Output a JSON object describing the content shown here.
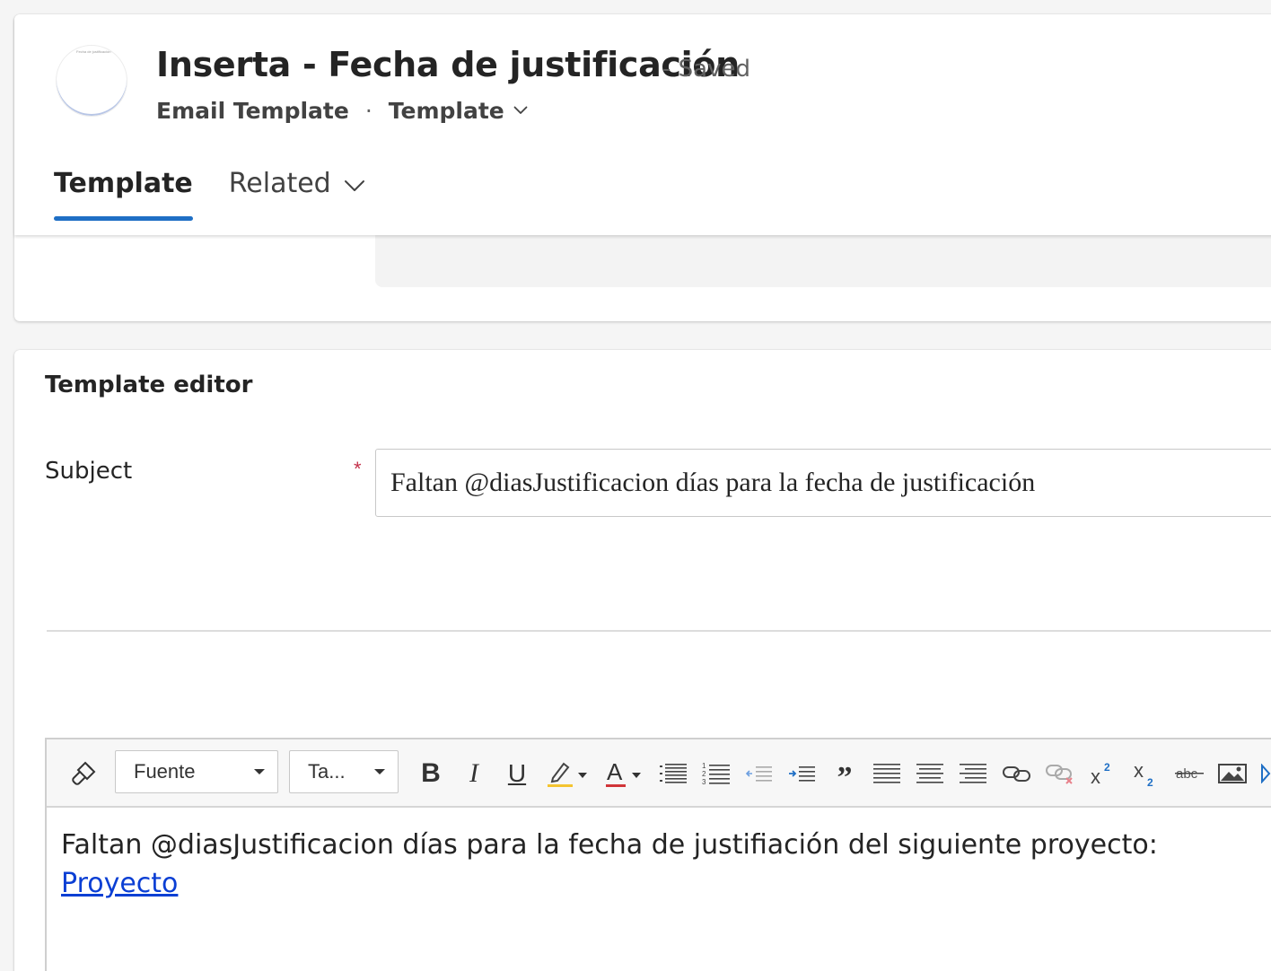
{
  "header": {
    "avatar_text": "Fecha de justificación",
    "title": "Inserta - Fecha de justificación",
    "save_status": "- Saved",
    "entity": "Email Template",
    "separator": "·",
    "form_selector": "Template"
  },
  "tabs": [
    {
      "label": "Template",
      "active": true
    },
    {
      "label": "Related",
      "active": false
    }
  ],
  "editor": {
    "section_title": "Template editor",
    "subject_label": "Subject",
    "required_marker": "*",
    "subject_value": "Faltan @diasJustificacion días para la fecha de justificación"
  },
  "toolbar": {
    "font_select": "Fuente",
    "size_select": "Ta...",
    "items": [
      "format-painter-icon",
      "bold-icon",
      "italic-icon",
      "underline-icon",
      "highlight-icon",
      "font-color-icon",
      "bullet-list-icon",
      "numbered-list-icon",
      "outdent-icon",
      "indent-icon",
      "quote-icon",
      "align-left-icon",
      "align-center-icon",
      "align-right-icon",
      "link-icon",
      "unlink-icon",
      "superscript-icon",
      "subscript-icon",
      "strikethrough-icon",
      "image-icon"
    ]
  },
  "body": {
    "line1": "Faltan @diasJustificacion días para la fecha de justifiación del siguiente proyecto:",
    "link": "Proyecto"
  },
  "colors": {
    "accent": "#1f6fc5",
    "required": "#c4314b",
    "link": "#0b3fd4",
    "highlight": "#f4c430",
    "font_color": "#d13438"
  }
}
